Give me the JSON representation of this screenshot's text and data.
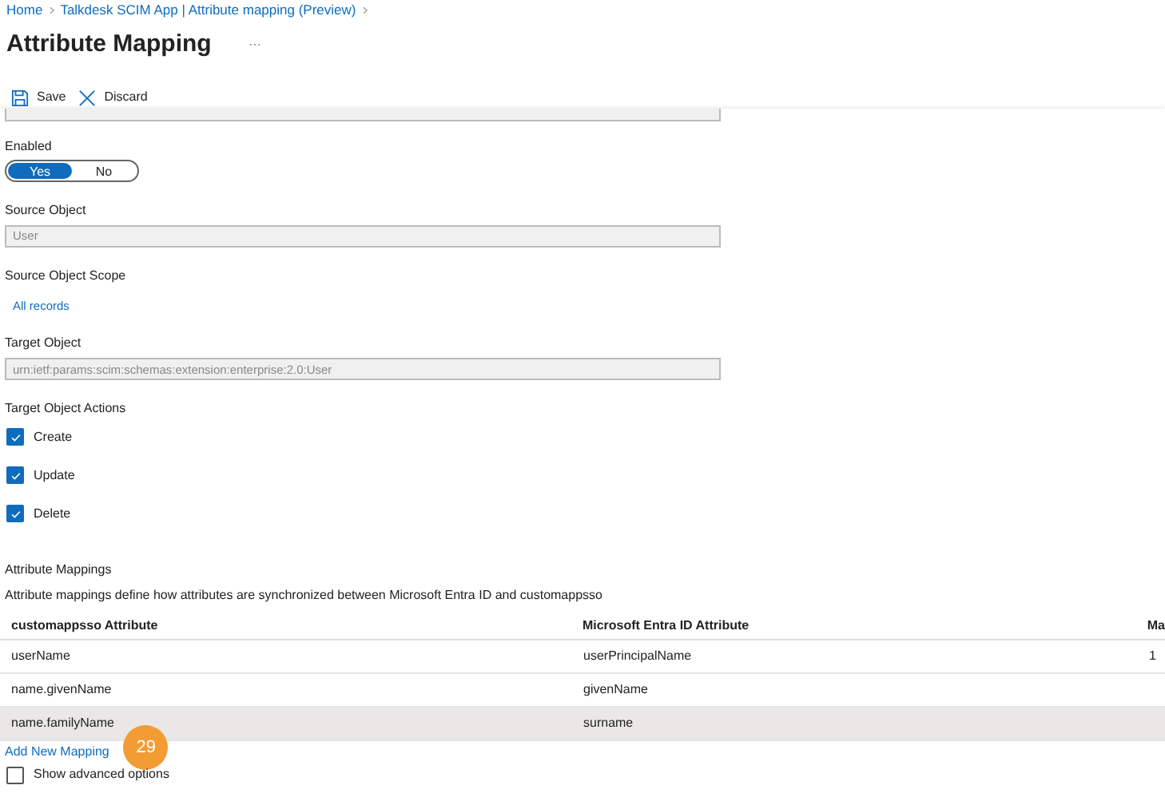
{
  "breadcrumb": [
    "Home",
    "Talkdesk SCIM App | Attribute mapping (Preview)"
  ],
  "title": "Attribute Mapping",
  "toolbar": [
    {
      "kind": "save",
      "label": "Save"
    },
    {
      "kind": "discard",
      "label": "Discard"
    }
  ],
  "enabled": {
    "label": "Enabled",
    "options": [
      {
        "label": "Yes",
        "selected": true
      },
      {
        "label": "No",
        "selected": false
      }
    ]
  },
  "source_object": {
    "label": "Source Object",
    "value": "User"
  },
  "source_scope": {
    "label": "Source Object Scope",
    "link": "All records"
  },
  "target_object": {
    "label": "Target Object",
    "value": "urn:ietf:params:scim:schemas:extension:enterprise:2.0:User"
  },
  "target_actions": {
    "label": "Target Object Actions",
    "items": [
      {
        "label": "Create",
        "checked": true
      },
      {
        "label": "Update",
        "checked": true
      },
      {
        "label": "Delete",
        "checked": true
      }
    ]
  },
  "mappings": {
    "title": "Attribute Mappings",
    "description": "Attribute mappings define how attributes are synchronized between Microsoft Entra ID and customappsso",
    "columns": [
      "customappsso Attribute",
      "Microsoft Entra ID Attribute",
      "Ma"
    ],
    "rows": [
      {
        "cells": [
          "userName",
          "userPrincipalName",
          "1"
        ],
        "selected": false
      },
      {
        "cells": [
          "name.givenName",
          "givenName",
          ""
        ],
        "selected": false
      },
      {
        "cells": [
          "name.familyName",
          "surname",
          ""
        ],
        "selected": true
      }
    ],
    "add_link": "Add New Mapping",
    "badge": "29"
  },
  "advanced": {
    "label": "Show advanced options",
    "checked": false
  }
}
